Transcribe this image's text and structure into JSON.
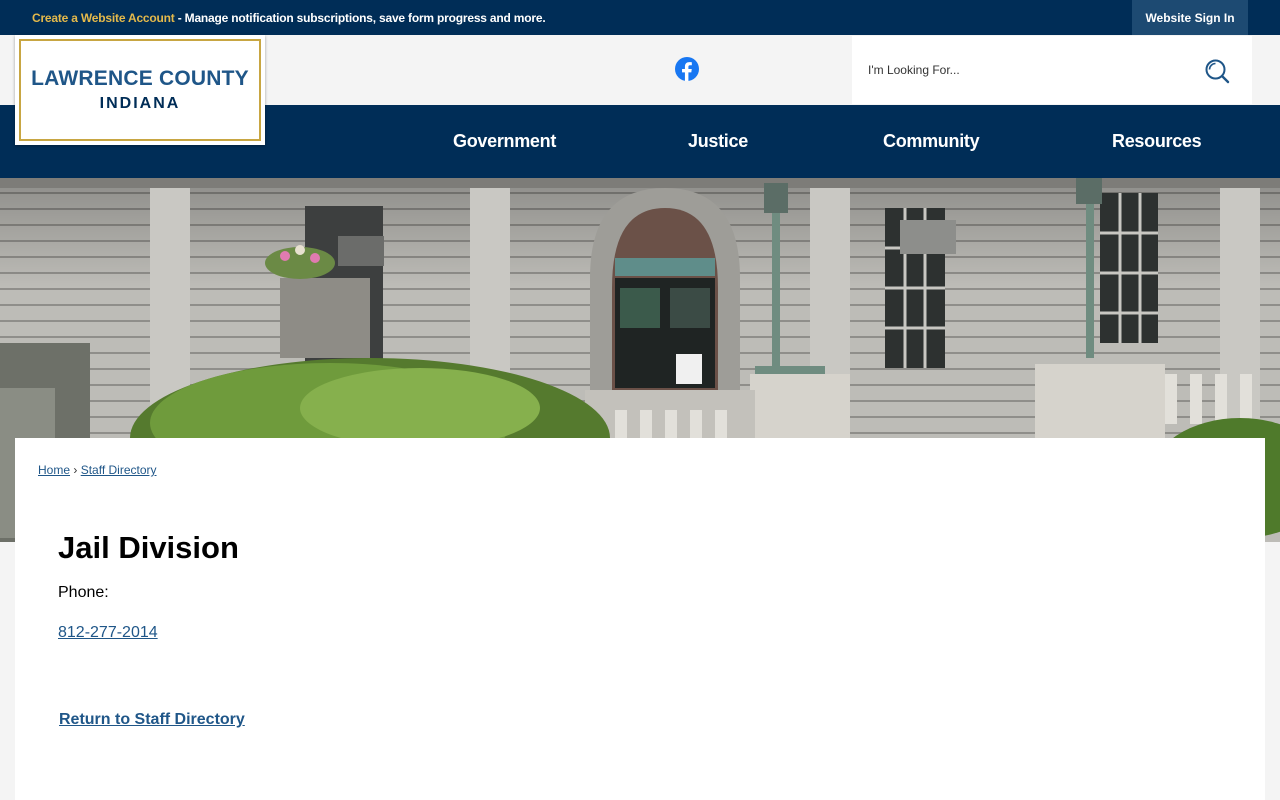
{
  "topbar": {
    "create_link": "Create a Website Account",
    "message": " - Manage notification subscriptions, save form progress and more.",
    "signin_label": "Website Sign In"
  },
  "logo": {
    "line1": "LAWRENCE COUNTY",
    "line2": "INDIANA"
  },
  "header": {
    "social_icon": "facebook-icon",
    "search_placeholder": "I'm Looking For...",
    "search_icon": "search-icon"
  },
  "nav": {
    "items": [
      {
        "label": "Government"
      },
      {
        "label": "Justice"
      },
      {
        "label": "Community"
      },
      {
        "label": "Resources"
      }
    ]
  },
  "breadcrumb": {
    "home": "Home",
    "separator": "›",
    "current": "Staff Directory"
  },
  "main": {
    "title": "Jail Division",
    "phone_label": "Phone:",
    "phone_value": "812-277-2014",
    "return_link": "Return to Staff Directory"
  },
  "colors": {
    "navy": "#002d57",
    "accent_gold": "#e4b94b",
    "logo_border": "#c8a642",
    "link_blue": "#1f5688",
    "facebook_blue": "#1877f2"
  }
}
